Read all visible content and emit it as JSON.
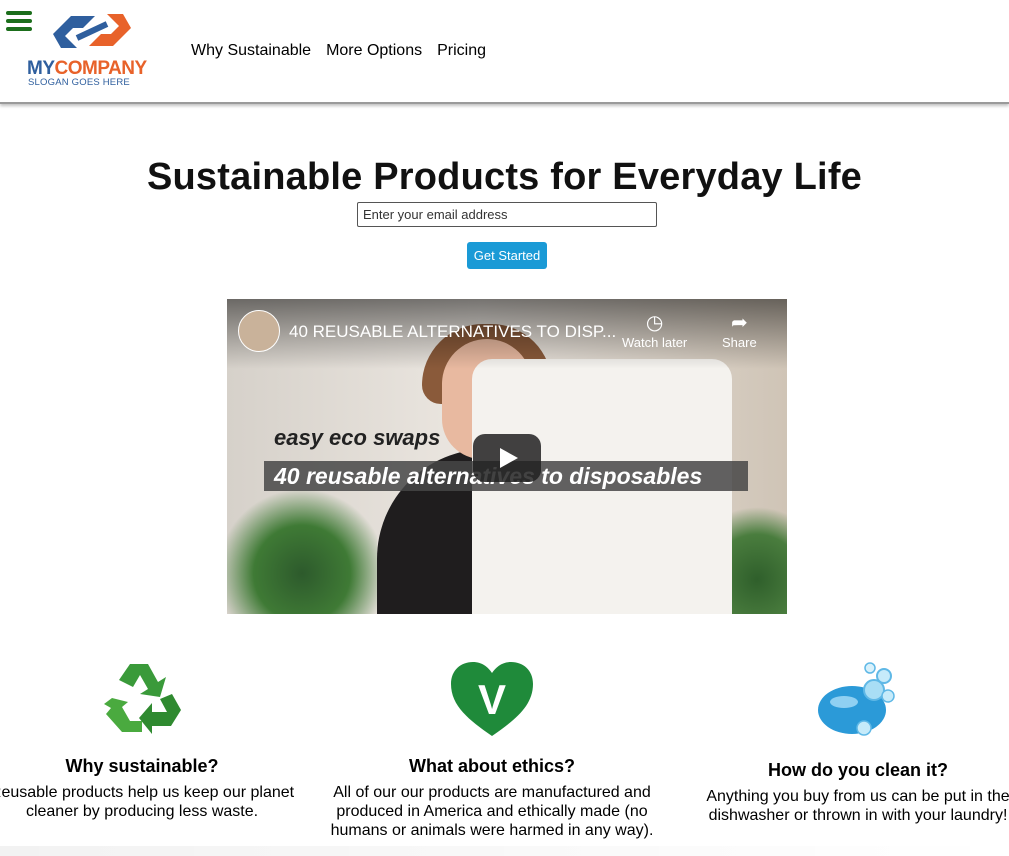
{
  "header": {
    "logo": {
      "name_my": "MY",
      "name_company": "COMPANY",
      "slogan": "SLOGAN GOES HERE"
    },
    "nav": [
      "Why Sustainable",
      "More Options",
      "Pricing"
    ],
    "menu_icon": "hamburger-menu-icon"
  },
  "hero": {
    "title": "Sustainable Products for Everyday Life",
    "email_placeholder": "Enter your email address",
    "cta_label": "Get Started"
  },
  "video": {
    "title": "40 REUSABLE ALTERNATIVES TO DISP...",
    "watch_later": "Watch later",
    "share": "Share",
    "overlay_top": "easy eco swaps",
    "overlay_main": "40 reusable alternatives to disposables"
  },
  "features": [
    {
      "icon": "recycle-icon",
      "title": "Why sustainable?",
      "text": "Reusable products help us keep our planet cleaner by producing less waste."
    },
    {
      "icon": "vegan-heart-icon",
      "title": "What about ethics?",
      "text": "All of our our products are manufactured and produced in America and ethically made (no humans or animals were harmed in any way)."
    },
    {
      "icon": "soap-icon",
      "title": "How do you clean it?",
      "text": "Anything you buy from us can be put in the dishwasher or thrown in with your laundry!"
    }
  ],
  "colors": {
    "accent": "#1a9ad6",
    "menu": "#1b6e1b",
    "logo_blue": "#2f5f9e",
    "logo_orange": "#e8622a",
    "heart": "#1f8a3a",
    "recycle": "#3a9a3a"
  }
}
